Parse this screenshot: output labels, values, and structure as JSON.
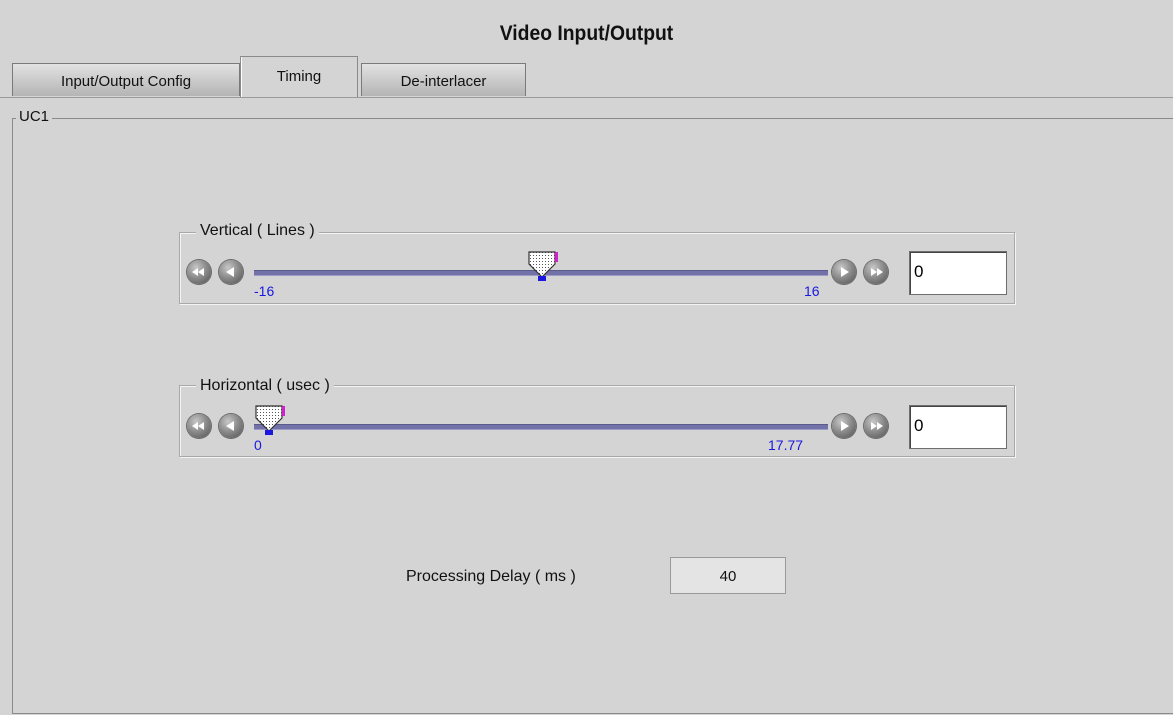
{
  "window": {
    "title": "Video Input/Output"
  },
  "tabs": [
    {
      "label": "Input/Output Config",
      "active": false
    },
    {
      "label": "Timing",
      "active": true
    },
    {
      "label": "De-interlacer",
      "active": false
    }
  ],
  "panel": {
    "title": "UC1",
    "vertical": {
      "label": "Vertical ( Lines )",
      "min_label": "-16",
      "max_label": "16",
      "min": -16,
      "max": 16,
      "value": 0,
      "input_value": "0"
    },
    "horizontal": {
      "label": "Horizontal ( usec )",
      "min_label": "0",
      "max_label": "17.77",
      "min": 0,
      "max": 17.77,
      "value": 0,
      "input_value": "0"
    },
    "processing_delay": {
      "label": "Processing Delay ( ms )",
      "value": "40"
    }
  },
  "icons": {
    "fast_rewind": "fast-rewind-icon",
    "step_back": "step-back-icon",
    "step_forward": "step-forward-icon",
    "fast_forward": "fast-forward-icon",
    "slider_thumb": "slider-thumb-icon"
  },
  "colors": {
    "track": "#7272a8",
    "tick_label": "#1818e0",
    "background": "#d4d4d4"
  }
}
